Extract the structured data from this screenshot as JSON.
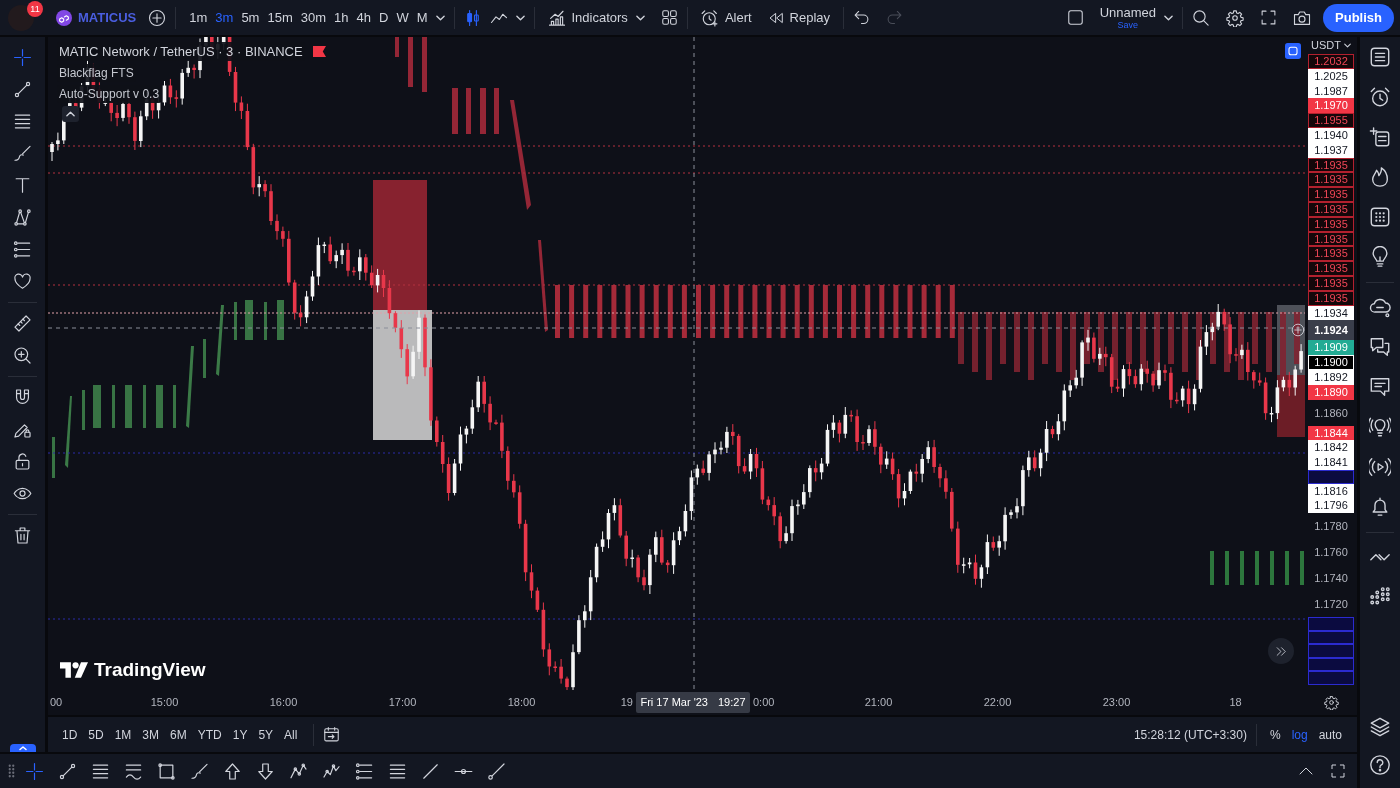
{
  "top_toolbar": {
    "notification_count": "11",
    "symbol": "MATICUS",
    "intervals": [
      {
        "label": "1m",
        "selected": false
      },
      {
        "label": "3m",
        "selected": true
      },
      {
        "label": "5m",
        "selected": false
      },
      {
        "label": "15m",
        "selected": false
      },
      {
        "label": "30m",
        "selected": false
      },
      {
        "label": "1h",
        "selected": false
      },
      {
        "label": "4h",
        "selected": false
      },
      {
        "label": "D",
        "selected": false
      },
      {
        "label": "W",
        "selected": false
      },
      {
        "label": "M",
        "selected": false
      }
    ],
    "chart_styles": [
      {
        "selected": true
      },
      {
        "selected": false
      }
    ],
    "indicators": "Indicators",
    "alert": "Alert",
    "replay": "Replay",
    "undo": {
      "disabled": false
    },
    "redo": {
      "disabled": true
    },
    "layout": {
      "name": "Unnamed",
      "status": "Save"
    },
    "publish": "Publish"
  },
  "left_toolbar": {
    "tools": [
      {
        "selected": true
      },
      {
        "selected": false
      },
      {
        "selected": false
      },
      {
        "selected": false
      },
      {
        "selected": false
      },
      {
        "selected": false
      },
      {
        "selected": false
      },
      {
        "selected": false
      },
      {
        "selected": false
      },
      {
        "selected": false
      },
      {
        "selected": false
      },
      {
        "selected": false
      },
      {
        "selected": false
      },
      {
        "selected": false
      },
      {
        "selected": false
      }
    ]
  },
  "chart": {
    "legend": {
      "title": "MATIC Network / TetherUS · 3 · BINANCE",
      "studies": [
        "Blackflag FTS",
        "Auto-Support v 0.3"
      ]
    },
    "logo": "TradingView"
  },
  "price_axis": {
    "currency": "USDT",
    "labels": [
      {
        "text": "1.2032",
        "kind": "dark-red"
      },
      {
        "text": "1.2025",
        "kind": "light"
      },
      {
        "text": "1.1987",
        "kind": "light"
      },
      {
        "text": "1.1970",
        "kind": "red"
      },
      {
        "text": "1.1955",
        "kind": "dark-red"
      },
      {
        "text": "1.1940",
        "kind": "light"
      },
      {
        "text": "1.1937",
        "kind": "light"
      },
      {
        "text": "1.1935",
        "kind": "dark-red"
      },
      {
        "text": "1.1935",
        "kind": "dark-red"
      },
      {
        "text": "1.1935",
        "kind": "dark-red"
      },
      {
        "text": "1.1935",
        "kind": "dark-red"
      },
      {
        "text": "1.1935",
        "kind": "dark-red"
      },
      {
        "text": "1.1935",
        "kind": "dark-red"
      },
      {
        "text": "1.1935",
        "kind": "dark-red"
      },
      {
        "text": "1.1935",
        "kind": "dark-red"
      },
      {
        "text": "1.1935",
        "kind": "dark-red"
      },
      {
        "text": "1.1935",
        "kind": "dark-red"
      },
      {
        "text": "1.1934",
        "kind": "light"
      },
      {
        "text": "1.1924",
        "kind": "crosshair"
      },
      {
        "text": "1.1909",
        "kind": "green"
      },
      {
        "text": "1.1900",
        "kind": "dark"
      },
      {
        "text": "1.1892",
        "kind": "light"
      },
      {
        "text": "1.1890",
        "kind": "red"
      },
      {
        "text": "1.1860",
        "kind": "tick"
      },
      {
        "text": "1.1844",
        "kind": "red"
      },
      {
        "text": "1.1842",
        "kind": "light"
      },
      {
        "text": "1.1841",
        "kind": "light"
      },
      {
        "kind": "blank"
      },
      {
        "text": "1.1816",
        "kind": "light"
      },
      {
        "text": "1.1796",
        "kind": "light"
      },
      {
        "text": "1.1780",
        "kind": "tick"
      },
      {
        "text": "1.1760",
        "kind": "tick"
      },
      {
        "text": "1.1740",
        "kind": "tick"
      },
      {
        "text": "1.1720",
        "kind": "tick"
      },
      {
        "kind": "blank"
      },
      {
        "kind": "blank"
      },
      {
        "kind": "blank"
      },
      {
        "kind": "blank"
      },
      {
        "kind": "blank"
      }
    ]
  },
  "time_axis": {
    "labels": [
      {
        "kind": "start",
        "text": "00"
      },
      {
        "kind": "tick",
        "text": "15:00"
      },
      {
        "kind": "tick",
        "text": "16:00"
      },
      {
        "kind": "tick",
        "text": "17:00"
      },
      {
        "kind": "tick",
        "text": "18:00"
      },
      {
        "kind": "before-cursor",
        "text": "19"
      },
      {
        "kind": "cursor",
        "date": "Fri 17 Mar '23",
        "time": "19:27"
      },
      {
        "kind": "after-cursor",
        "text": "0:00"
      },
      {
        "kind": "tick",
        "text": "21:00"
      },
      {
        "kind": "tick",
        "text": "22:00"
      },
      {
        "kind": "tick",
        "text": "23:00"
      },
      {
        "kind": "tick",
        "text": "18"
      }
    ]
  },
  "range_bar": {
    "ranges": [
      "1D",
      "5D",
      "1M",
      "3M",
      "6M",
      "YTD",
      "1Y",
      "5Y",
      "All"
    ],
    "clock": "15:28:12 (UTC+3:30)",
    "scale_options": [
      {
        "label": "%",
        "selected": false
      },
      {
        "label": "log",
        "selected": true
      },
      {
        "label": "auto",
        "selected": false
      }
    ]
  },
  "bottom_toolbar": {
    "tools": [
      {
        "selected": true
      },
      {
        "selected": false
      },
      {
        "selected": false
      },
      {
        "selected": false
      },
      {
        "selected": false
      },
      {
        "selected": false
      },
      {
        "selected": false
      },
      {
        "selected": false
      },
      {
        "selected": false
      },
      {
        "selected": false
      },
      {
        "selected": false
      },
      {
        "selected": false
      },
      {
        "selected": false
      },
      {
        "selected": false
      },
      {
        "selected": false
      }
    ]
  }
}
